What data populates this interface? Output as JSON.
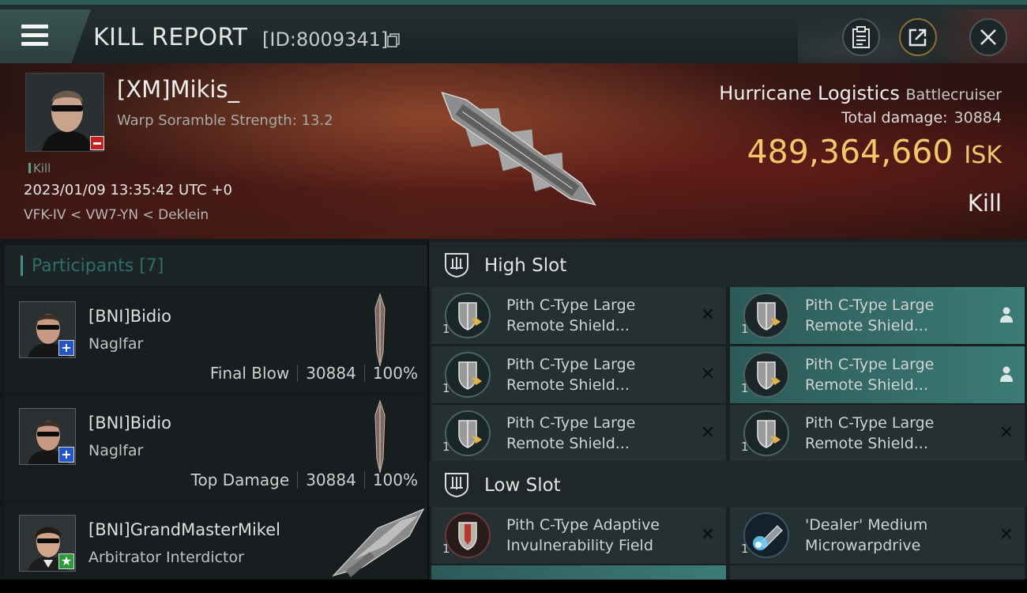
{
  "header": {
    "title": "KILL REPORT",
    "report_id": "[ID:8009341]"
  },
  "victim": {
    "name": "[XM]Mikis_",
    "warp_scramble": "Warp Soramble Strength: 13.2",
    "tag": "Kill",
    "datetime": "2023/01/09 13:35:42 UTC +0",
    "location": "VFK-IV < VW7-YN < Deklein",
    "ship": "Hurricane Logistics",
    "ship_class": "Battlecruiser",
    "total_damage_label": "Total damage:",
    "total_damage": "30884",
    "isk_value": "489,364,660",
    "isk_unit": "ISK",
    "result": "Kill"
  },
  "participants": {
    "title": "Participants [7]",
    "rows": [
      {
        "name": "[BNI]Bidio",
        "ship": "Naglfar",
        "role": "Final Blow",
        "damage": "30884",
        "percent": "100%",
        "badge": "+"
      },
      {
        "name": "[BNI]Bidio",
        "ship": "Naglfar",
        "role": "Top Damage",
        "damage": "30884",
        "percent": "100%",
        "badge": "+"
      },
      {
        "name": "[BNI]GrandMasterMikel",
        "ship": "Arbitrator Interdictor",
        "role": "",
        "damage": "",
        "percent": "",
        "badge": "★"
      }
    ]
  },
  "fitting": {
    "high_slot": {
      "title": "High Slot",
      "modules": [
        {
          "line1": "Pith C-Type Large",
          "line2": "Remote Shield...",
          "qty": "1",
          "status": "destroyed"
        },
        {
          "line1": "Pith C-Type Large",
          "line2": "Remote Shield...",
          "qty": "1",
          "status": "dropped"
        },
        {
          "line1": "Pith C-Type Large",
          "line2": "Remote Shield...",
          "qty": "1",
          "status": "destroyed"
        },
        {
          "line1": "Pith C-Type Large",
          "line2": "Remote Shield...",
          "qty": "1",
          "status": "dropped"
        },
        {
          "line1": "Pith C-Type Large",
          "line2": "Remote Shield...",
          "qty": "1",
          "status": "destroyed"
        },
        {
          "line1": "Pith C-Type Large",
          "line2": "Remote Shield...",
          "qty": "1",
          "status": "destroyed"
        }
      ]
    },
    "low_slot": {
      "title": "Low Slot",
      "modules": [
        {
          "line1": "Pith C-Type Adaptive",
          "line2": "Invulnerability Field",
          "qty": "1",
          "status": "destroyed"
        },
        {
          "line1": "'Dealer' Medium",
          "line2": "Microwarpdrive",
          "qty": "1",
          "status": "destroyed"
        }
      ]
    }
  },
  "colors": {
    "accent": "#3d8f87",
    "isk": "#f2c86a",
    "dropped": "#3c7b77",
    "badge_minus": "#c62020",
    "badge_plus": "#2255cc",
    "badge_star": "#2a9a3c"
  },
  "icons": {
    "menu": "hamburger-icon",
    "copy": "copy-icon",
    "clipboard": "clipboard-icon",
    "share": "share-icon",
    "close": "close-icon",
    "high_slot": "high-slot-icon",
    "low_slot": "low-slot-icon",
    "destroyed": "x-icon",
    "dropped": "person-icon"
  }
}
